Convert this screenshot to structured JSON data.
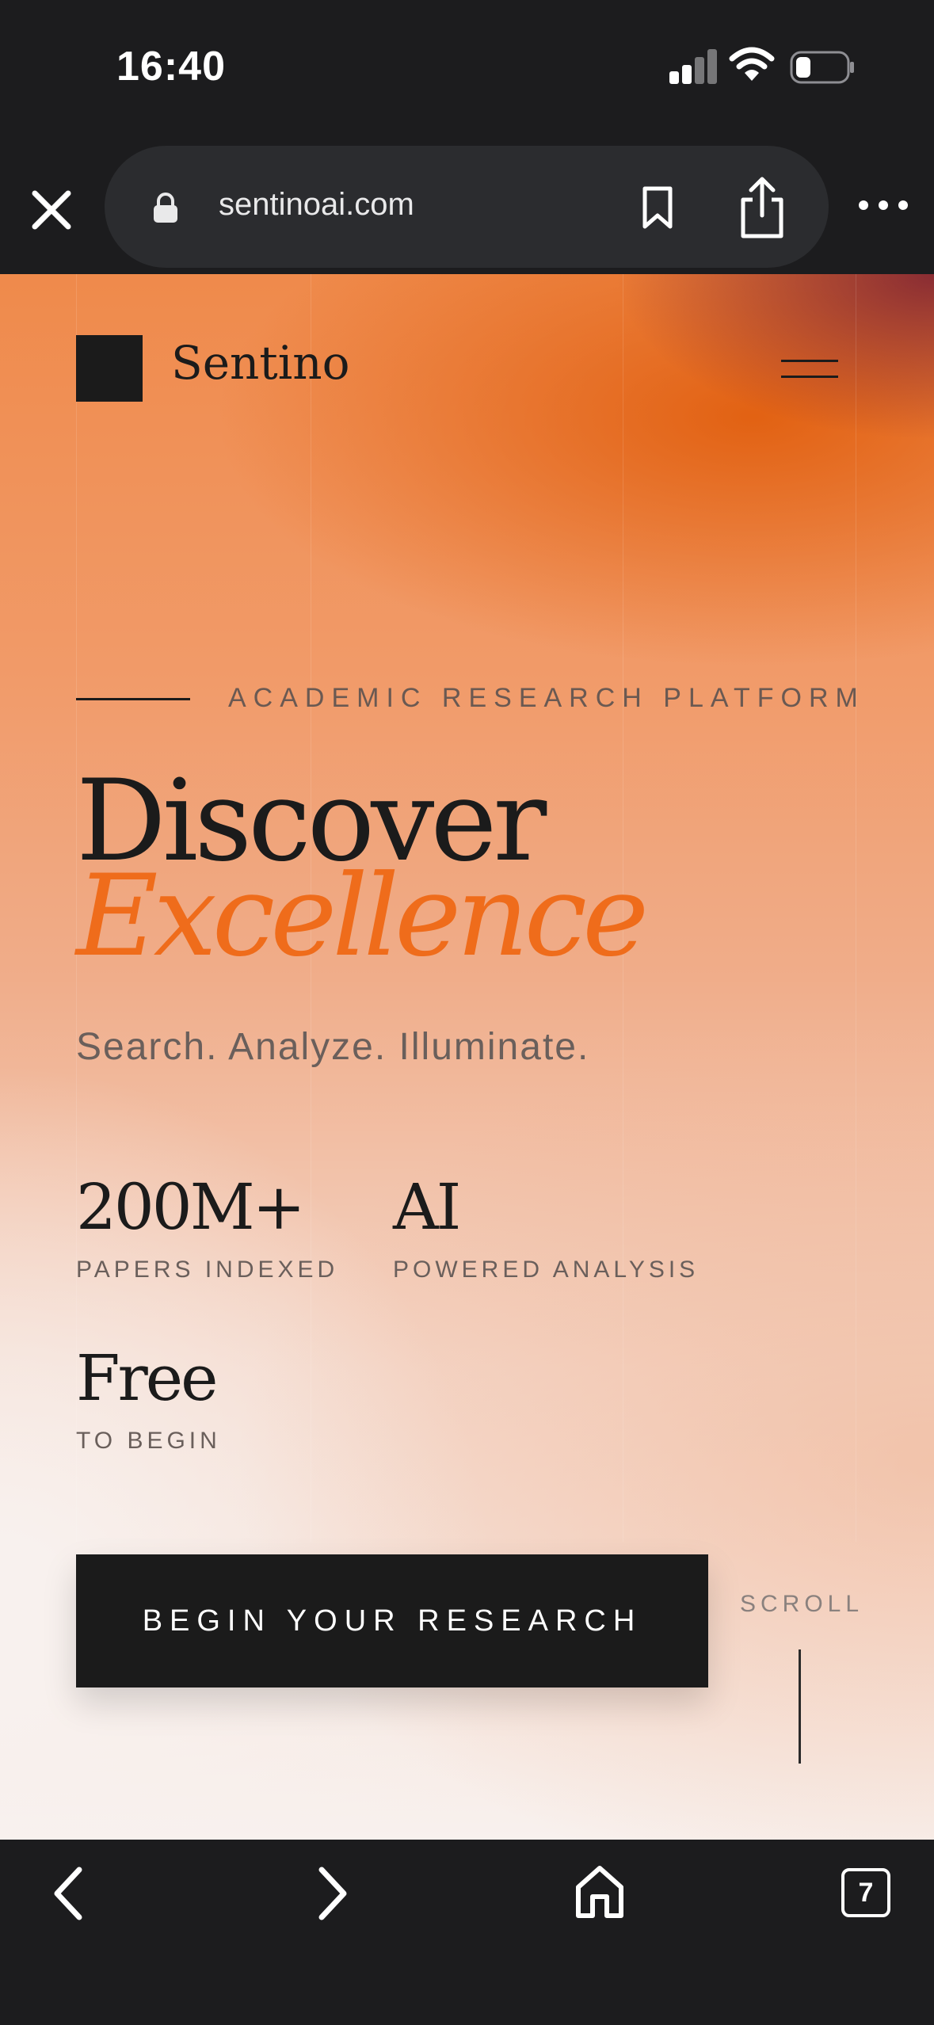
{
  "status_bar": {
    "time": "16:40",
    "signal_icon": "signal-icon",
    "wifi_icon": "wifi-icon",
    "battery_icon": "battery-icon"
  },
  "browser": {
    "url": "sentinoai.com",
    "close_icon": "close-icon",
    "lock_icon": "lock-icon",
    "bookmark_icon": "bookmark-icon",
    "share_icon": "share-icon",
    "more_icon": "more-icon",
    "tab_count": "7"
  },
  "site": {
    "brand": "Sentino",
    "eyebrow": "ACADEMIC RESEARCH PLATFORM",
    "headline_line1": "Discover",
    "headline_line2": "Excellence",
    "tagline": "Search. Analyze. Illuminate.",
    "stats": [
      {
        "value": "200M+",
        "label": "PAPERS INDEXED"
      },
      {
        "value": "AI",
        "label": "POWERED ANALYSIS"
      },
      {
        "value": "Free",
        "label": "TO BEGIN"
      }
    ],
    "cta": "BEGIN YOUR RESEARCH",
    "scroll_label": "SCROLL"
  },
  "colors": {
    "accent": "#ef6c1b",
    "dark": "#1b1b1b",
    "chrome": "#1c1c1e"
  }
}
